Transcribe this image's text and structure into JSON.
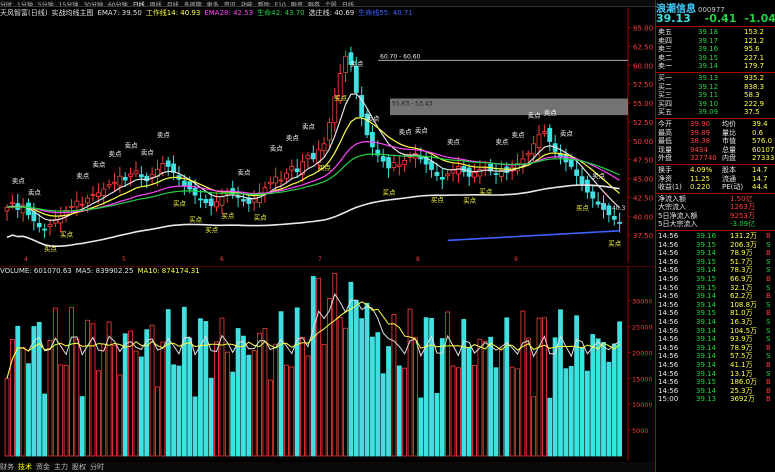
{
  "menu": [
    "资讯",
    "功能",
    "帮助",
    "F10",
    "融资",
    "融券",
    "个股",
    "日线"
  ],
  "periods": [
    "分时",
    "1分钟",
    "5分钟",
    "15分钟",
    "30分钟",
    "60分钟",
    "日线",
    "周线",
    "月线",
    "多周期",
    "更多"
  ],
  "active_period": "日线",
  "indicator_line": [
    {
      "text": "天风智富(日线)",
      "color": "#e0e0e0"
    },
    {
      "text": "实战均线主图",
      "color": "#e0e0e0"
    },
    {
      "text": "EMA7: 39.50",
      "color": "#e0e0e0"
    },
    {
      "text": "工作线14: 40.93",
      "color": "#ffff44"
    },
    {
      "text": "EMA28: 42.53",
      "color": "#ff44ff"
    },
    {
      "text": "生命42: 43.70",
      "color": "#22d044"
    },
    {
      "text": "选庄线: 40.69",
      "color": "#e0e0e0"
    },
    {
      "text": "生命线55: 40.71",
      "color": "#4060ff"
    }
  ],
  "volume_line": [
    {
      "text": "VOLUME: 601070.63",
      "color": "#e0e0e0"
    },
    {
      "text": "MA5: 839902.25",
      "color": "#e0e0e0"
    },
    {
      "text": "MA10: 874174.31",
      "color": "#ffff44"
    }
  ],
  "bottom_tabs": [
    "财务",
    "技术",
    "资金",
    "主力",
    "股权",
    "分时"
  ],
  "active_bottom_tab": "技术",
  "right_panel": {
    "brand": "浪潮信息",
    "code": "000977",
    "price": "39.13",
    "change": "-0.41",
    "pct": "-1.04%",
    "ask": [
      {
        "label": "卖五",
        "price": "39.18",
        "vol": "153.2"
      },
      {
        "label": "卖四",
        "price": "39.17",
        "vol": "121.2"
      },
      {
        "label": "卖三",
        "price": "39.16",
        "vol": "95.6"
      },
      {
        "label": "卖二",
        "price": "39.15",
        "vol": "227.1"
      },
      {
        "label": "卖一",
        "price": "39.14",
        "vol": "179.7"
      }
    ],
    "bid": [
      {
        "label": "买一",
        "price": "39.13",
        "vol": "935.2"
      },
      {
        "label": "买二",
        "price": "39.12",
        "vol": "838.3"
      },
      {
        "label": "买三",
        "price": "39.11",
        "vol": "58.3"
      },
      {
        "label": "买四",
        "price": "39.10",
        "vol": "222.9"
      },
      {
        "label": "买五",
        "price": "39.09",
        "vol": "37.5"
      }
    ],
    "stats": [
      {
        "l1": "今开",
        "v1": "39.90",
        "l2": "均价",
        "v2": "39.4"
      },
      {
        "l1": "最高",
        "v1": "39.89",
        "l2": "量比",
        "v2": "0.6"
      },
      {
        "l1": "最低",
        "v1": "38.38",
        "l2": "市值",
        "v2": "576.0"
      },
      {
        "l1": "现量",
        "v1": "9434",
        "l2": "总量",
        "v2": "60107"
      },
      {
        "l1": "外盘",
        "v1": "327740",
        "l2": "内盘",
        "v2": "27333"
      }
    ],
    "stats2": [
      {
        "l1": "换手",
        "v1": "4.09%",
        "l2": "股本",
        "v2": "14.7"
      },
      {
        "l1": "净资",
        "v1": "11.25",
        "l2": "流通",
        "v2": "14.7"
      },
      {
        "l1": "收益(1)",
        "v1": "0.220",
        "l2": "PE(动)",
        "v2": "44.4"
      }
    ],
    "flow": [
      {
        "label": "净流入额",
        "value": "1.50亿"
      },
      {
        "label": "大宗流入",
        "value": "1263万"
      },
      {
        "label": "5日净流入额",
        "value": "9253万"
      },
      {
        "label": "5日大宗流入",
        "value": "-3.09亿"
      }
    ],
    "ticks": [
      {
        "t": "14:56",
        "p": "39.16",
        "v": "131.2万",
        "d": "B"
      },
      {
        "t": "14:56",
        "p": "39.15",
        "v": "206.3万",
        "d": "S"
      },
      {
        "t": "14:56",
        "p": "39.14",
        "v": "78.9万",
        "d": "B"
      },
      {
        "t": "14:56",
        "p": "39.15",
        "v": "51.7万",
        "d": "S"
      },
      {
        "t": "14:56",
        "p": "39.14",
        "v": "78.3万",
        "d": "S"
      },
      {
        "t": "14:56",
        "p": "39.15",
        "v": "66.9万",
        "d": "B"
      },
      {
        "t": "14:56",
        "p": "39.15",
        "v": "32.1万",
        "d": "S"
      },
      {
        "t": "14:56",
        "p": "39.14",
        "v": "62.2万",
        "d": "B"
      },
      {
        "t": "14:56",
        "p": "39.14",
        "v": "108.8万",
        "d": "S"
      },
      {
        "t": "14:56",
        "p": "39.15",
        "v": "81.0万",
        "d": "B"
      },
      {
        "t": "14:56",
        "p": "39.14",
        "v": "16.3万",
        "d": "S"
      },
      {
        "t": "14:56",
        "p": "39.14",
        "v": "104.5万",
        "d": "S"
      },
      {
        "t": "14:56",
        "p": "39.14",
        "v": "93.9万",
        "d": "S"
      },
      {
        "t": "14:56",
        "p": "39.14",
        "v": "78.9万",
        "d": "B"
      },
      {
        "t": "14:56",
        "p": "39.14",
        "v": "57.5万",
        "d": "S"
      },
      {
        "t": "14:56",
        "p": "39.14",
        "v": "41.1万",
        "d": "B"
      },
      {
        "t": "14:56",
        "p": "39.14",
        "v": "13.1万",
        "d": "S"
      },
      {
        "t": "14:56",
        "p": "39.15",
        "v": "186.0万",
        "d": "B"
      },
      {
        "t": "14:56",
        "p": "39.14",
        "v": "25.3万",
        "d": "B"
      },
      {
        "t": "15:00",
        "p": "39.13",
        "v": "3692万",
        "d": "B"
      }
    ]
  },
  "chart_data": [
    {
      "type": "candlestick",
      "title": "",
      "ylim": [
        35,
        66
      ],
      "yticks": [
        "65.00",
        "62.50",
        "60.00",
        "57.50",
        "55.00",
        "52.50",
        "50.00",
        "47.50",
        "45.00",
        "42.50",
        "40.00",
        "37.50"
      ],
      "xticks": [
        "4",
        "5",
        "6",
        "7",
        "8",
        "9"
      ],
      "annotations": [
        "60.70 - 60.60",
        "55.63 - 53.43",
        "40.3",
        "卖点",
        "卖点",
        "买点",
        "买点",
        "卖点",
        "卖点",
        "卖点",
        "卖点",
        "卖点",
        "卖点",
        "买点",
        "买点",
        "买点",
        "买点",
        "卖点",
        "买点",
        "卖点",
        "卖点",
        "卖点",
        "买点",
        "买点",
        "卖点",
        "卖点",
        "买点",
        "卖点",
        "卖点",
        "买点",
        "卖点",
        "买点",
        "买点",
        "卖点",
        "卖点",
        "卖点",
        "卖点",
        "卖点",
        "买点",
        "卖点",
        "买点"
      ],
      "series": [
        {
          "name": "EMA7",
          "color": "#e0e0e0"
        },
        {
          "name": "工作线14",
          "color": "#ffff44"
        },
        {
          "name": "EMA28",
          "color": "#ff44ff"
        },
        {
          "name": "生命42",
          "color": "#22d044"
        },
        {
          "name": "生命线55",
          "color": "#4060ff"
        }
      ],
      "closes": [
        41.2,
        41.8,
        40.9,
        41.5,
        40.2,
        39.4,
        38.6,
        38.2,
        38.9,
        39.6,
        40.1,
        40.8,
        41.3,
        42.0,
        41.6,
        42.4,
        42.9,
        43.1,
        43.6,
        44.2,
        44.5,
        45.3,
        44.8,
        45.6,
        46.0,
        45.2,
        44.7,
        45.5,
        46.2,
        47.0,
        46.6,
        45.8,
        44.9,
        44.1,
        43.6,
        42.8,
        42.2,
        41.8,
        41.4,
        41.9,
        42.6,
        43.3,
        43.0,
        42.5,
        42.0,
        41.7,
        42.3,
        43.1,
        43.8,
        44.5,
        45.2,
        44.8,
        45.7,
        46.6,
        45.9,
        47.2,
        48.1,
        47.6,
        48.8,
        49.6,
        52.4,
        55.8,
        58.9,
        61.2,
        60.1,
        56.4,
        53.2,
        50.8,
        49.2,
        48.1,
        47.3,
        46.4,
        47.1,
        46.8,
        47.4,
        47.9,
        48.3,
        47.6,
        46.9,
        46.2,
        45.4,
        44.9,
        45.6,
        46.1,
        46.6,
        45.9,
        45.3,
        45.8,
        46.2,
        46.5,
        46.0,
        45.6,
        46.1,
        45.8,
        46.5,
        47.0,
        47.6,
        48.3,
        49.6,
        50.8,
        51.2,
        49.9,
        48.6,
        47.8,
        47.2,
        46.6,
        45.4,
        44.3,
        43.2,
        42.4,
        41.6,
        40.9,
        40.2,
        39.6,
        39.13
      ]
    },
    {
      "type": "bar",
      "title": "",
      "ylim": [
        0,
        34000
      ],
      "yticks": [
        "30000",
        "25000",
        "20000",
        "15000",
        "10000",
        "5000"
      ],
      "series": [
        {
          "name": "VOLUME",
          "color": "#40e0e0"
        },
        {
          "name": "MA5",
          "color": "#e0e0e0"
        },
        {
          "name": "MA10",
          "color": "#ffff44"
        }
      ]
    }
  ]
}
